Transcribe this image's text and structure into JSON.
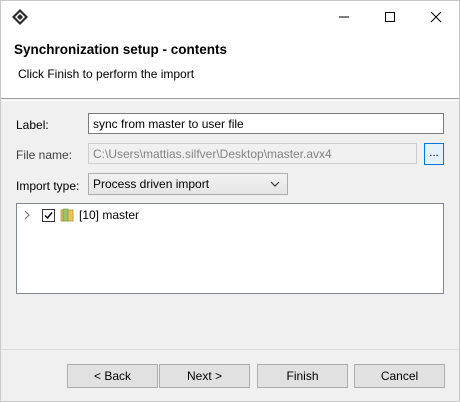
{
  "window": {
    "controls": {
      "minimize_icon": "minimize-icon",
      "maximize_icon": "maximize-icon",
      "close_icon": "close-icon"
    }
  },
  "header": {
    "title": "Synchronization setup - contents",
    "subtitle": "Click Finish to perform the import"
  },
  "form": {
    "label": {
      "caption": "Label:",
      "value": "sync from master to user file"
    },
    "file_name": {
      "caption": "File name:",
      "value": "C:\\Users\\mattias.silfver\\Desktop\\master.avx4",
      "browse_label": "..."
    },
    "import_type": {
      "caption": "Import type:",
      "selected": "Process driven import"
    }
  },
  "tree": {
    "items": [
      {
        "label": "[10] master",
        "checked": true,
        "expanded": false
      }
    ]
  },
  "buttons": {
    "back": "< Back",
    "next": "Next >",
    "finish": "Finish",
    "cancel": "Cancel"
  },
  "colors": {
    "accent": "#0078d7",
    "folder": "#e8c55a"
  }
}
